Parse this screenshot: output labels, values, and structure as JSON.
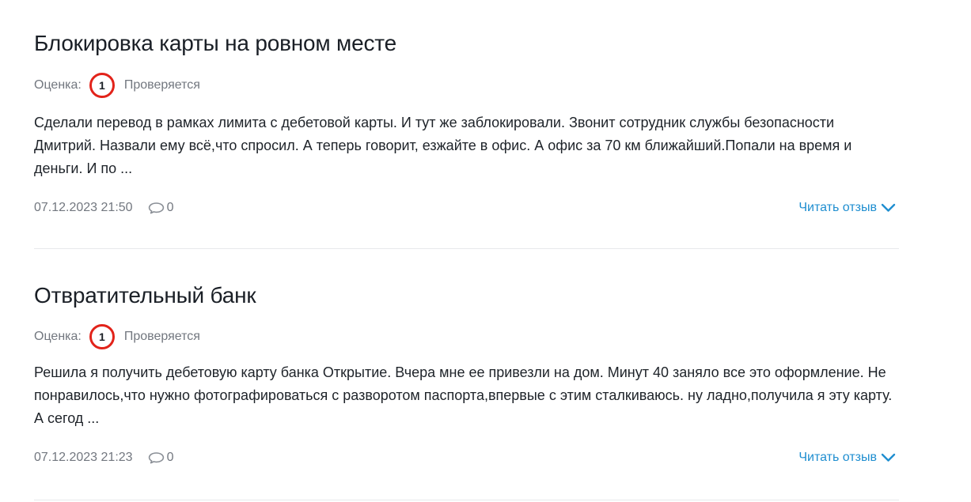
{
  "reviews": [
    {
      "title": "Блокировка карты на ровном месте",
      "rating_label": "Оценка:",
      "rating_value": "1",
      "status": "Проверяется",
      "text": "Сделали перевод в рамках лимита с дебетовой карты. И тут же заблокировали. Звонит сотрудник службы безопасности Дмитрий. Назвали ему всё,что спросил. А теперь говорит, езжайте в офис. А офис за 70 км ближайший.Попали на время и деньги. И по ...",
      "date": "07.12.2023 21:50",
      "comments_count": "0",
      "read_more": "Читать отзыв"
    },
    {
      "title": "Отвратительный банк",
      "rating_label": "Оценка:",
      "rating_value": "1",
      "status": "Проверяется",
      "text": "Решила я получить дебетовую карту банка Открытие. Вчера мне ее привезли на дом. Минут 40 заняло все это оформление. Не понравилось,что нужно фотографироваться с разворотом паспорта,впервые с этим сталкиваюсь. ну ладно,получила я эту карту. А сегод ...",
      "date": "07.12.2023 21:23",
      "comments_count": "0",
      "read_more": "Читать отзыв"
    }
  ],
  "colors": {
    "rating_ring": "#e2231a",
    "link": "#1f8ed0",
    "muted_text": "#72777f",
    "body_text": "#1e2329",
    "divider": "#e7e9ec"
  },
  "icons": {
    "comment": "speech-bubble-icon",
    "read_more": "chevron-down-icon"
  }
}
